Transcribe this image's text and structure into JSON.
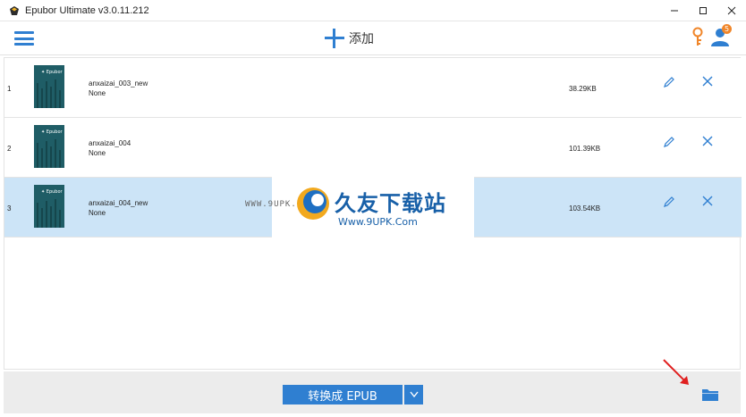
{
  "window": {
    "title": "Epubor Ultimate v3.0.11.212"
  },
  "toolbar": {
    "add_label": "添加",
    "badge_count": "5"
  },
  "books": [
    {
      "index": "1",
      "name": "anxaizai_003_new",
      "author": "None",
      "size": "38.29KB",
      "selected": false
    },
    {
      "index": "2",
      "name": "anxaizai_004",
      "author": "None",
      "size": "101.39KB",
      "selected": false
    },
    {
      "index": "3",
      "name": "anxaizai_004_new",
      "author": "None",
      "size": "103.54KB",
      "selected": true
    }
  ],
  "watermark": {
    "left_text": "WWW.9UPK.COM",
    "main_text": "久友下载站",
    "sub_text": "Www.9UPK.Com"
  },
  "bottom": {
    "convert_label": "转换成 EPUB"
  },
  "colors": {
    "accent": "#2f7fd1",
    "selected_row": "#cce4f7",
    "badge": "#f0862a",
    "key": "#f0862a"
  },
  "icons": {
    "menu": "hamburger-icon",
    "add": "plus-icon",
    "key": "key-icon",
    "user": "user-icon",
    "edit": "pencil-icon",
    "delete": "close-icon",
    "folder": "folder-icon",
    "dropdown": "chevron-down-icon"
  }
}
